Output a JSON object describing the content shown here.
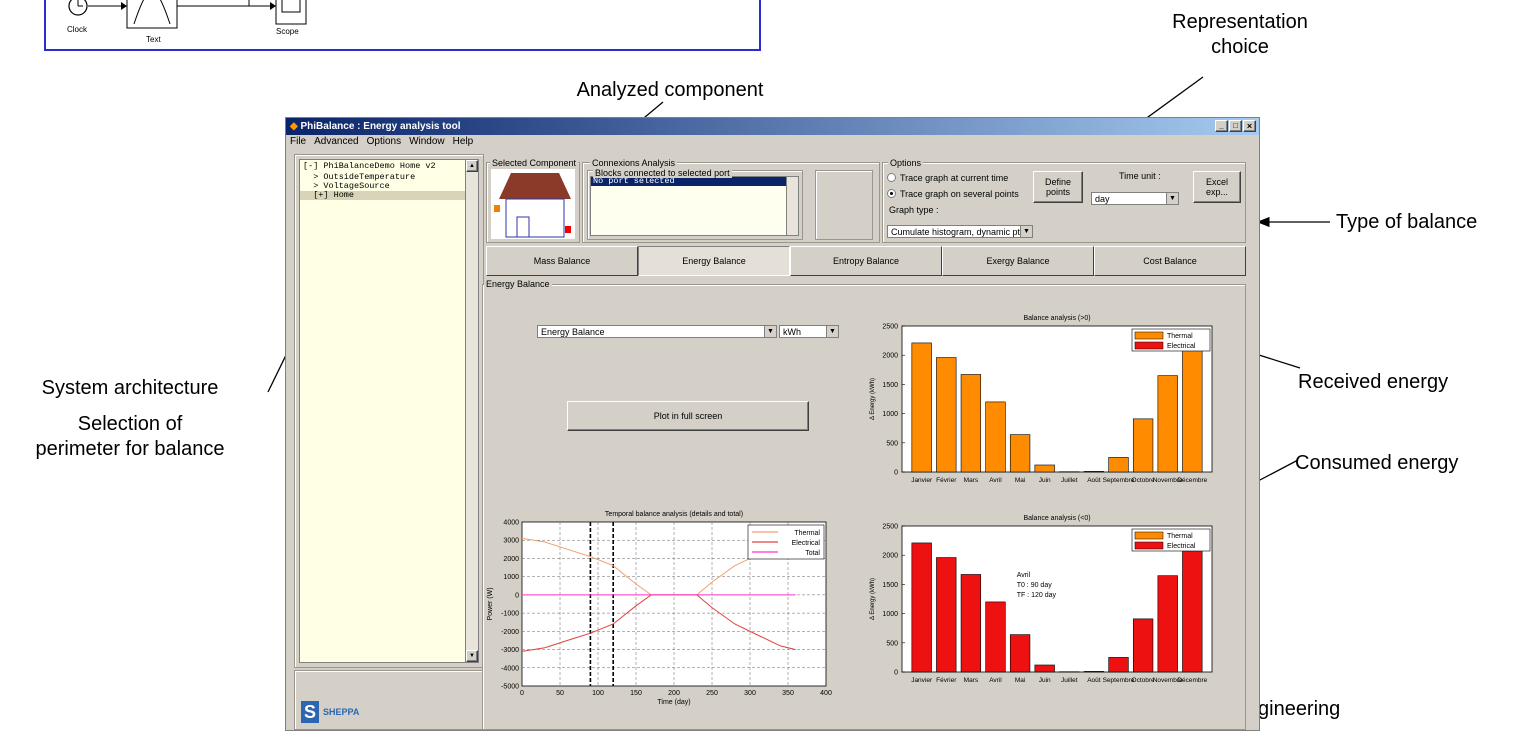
{
  "simulink": {
    "clock_label": "Clock",
    "text_label": "Text",
    "scope_label": "Scope"
  },
  "annotations": {
    "representation_choice_1": "Representation",
    "representation_choice_2": "choice",
    "analyzed_component": "Analyzed component",
    "type_of_balance": "Type of balance",
    "system_architecture": "System architecture",
    "selection_1": "Selection of",
    "selection_2": "perimeter for balance",
    "received_energy": "Received energy",
    "consumed_energy": "Consumed energy",
    "engineering_partial": "gineering"
  },
  "window": {
    "title": "PhiBalance : Energy analysis tool",
    "menu": [
      "File",
      "Advanced",
      "Options",
      "Window",
      "Help"
    ],
    "controls": [
      "_",
      "□",
      "×"
    ]
  },
  "tree": {
    "items": [
      "[-] PhiBalanceDemo Home v2",
      "  > OutsideTemperature",
      "  > VoltageSource",
      "  [+] Home"
    ]
  },
  "logo_text": "SHEPPA",
  "selected_component": {
    "label": "Selected Component"
  },
  "connexions": {
    "label": "Connexions Analysis",
    "sublabel": "Blocks connected to selected port",
    "selected_item": "No port selected"
  },
  "options": {
    "label": "Options",
    "radio_current": "Trace graph at current time",
    "radio_several": "Trace graph on several points",
    "selected_radio": "several",
    "define_points": "Define points",
    "time_unit_label": "Time unit :",
    "time_unit_value": "day",
    "excel_export": "Excel exp...",
    "graph_type_label": "Graph type :",
    "graph_type_value": "Cumulate histogram, dynamic pts."
  },
  "tabs": [
    "Mass Balance",
    "Energy Balance",
    "Entropy Balance",
    "Exergy Balance",
    "Cost Balance"
  ],
  "active_tab": "Energy Balance",
  "energy_panel": {
    "label": "Energy Balance",
    "balance_select": "Energy Balance",
    "unit_select": "kWh",
    "plot_fullscreen": "Plot in full screen"
  },
  "chart_data": [
    {
      "type": "bar",
      "title": "Balance analysis  (>0)",
      "ylabel": "Δ Energy (kWh)",
      "ylim": [
        0,
        2500
      ],
      "yticks": [
        0,
        500,
        1000,
        1500,
        2000,
        2500
      ],
      "categories": [
        "Janvier",
        "Février",
        "Mars",
        "Avril",
        "Mai",
        "Juin",
        "Juillet",
        "Août",
        "Septembre",
        "Octobre",
        "Novembre",
        "Décembre"
      ],
      "tick_labels": [
        "Janvier",
        "Février",
        "Mars",
        "Avril",
        "Mai",
        "Juin",
        "Juillet",
        "Août",
        "Septembre",
        "Octobre",
        "Novembre",
        "Décembre"
      ],
      "series": [
        {
          "name": "Thermal",
          "color": "#ff8c00",
          "values": [
            2210,
            1960,
            1670,
            1200,
            640,
            120,
            5,
            10,
            250,
            910,
            1650,
            2180
          ]
        },
        {
          "name": "Electrical",
          "color": "#ee1111",
          "values": [
            0,
            0,
            0,
            0,
            0,
            0,
            0,
            0,
            0,
            0,
            0,
            0
          ]
        }
      ],
      "legend": "top-right",
      "grid": false
    },
    {
      "type": "bar",
      "title": "Balance analysis  (<0)",
      "ylabel": "Δ Energy (kWh)",
      "ylim": [
        0,
        2500
      ],
      "yticks": [
        0,
        500,
        1000,
        1500,
        2000,
        2500
      ],
      "categories": [
        "Janvier",
        "Février",
        "Mars",
        "Avril",
        "Mai",
        "Juin",
        "Juillet",
        "Août",
        "Septembre",
        "Octobre",
        "Novembre",
        "Décembre"
      ],
      "tick_labels": [
        "Janvier",
        "Février",
        "Mars",
        "Avril",
        "Mai",
        "Juin",
        "Juillet",
        "Août",
        "Septembre",
        "Octobre",
        "Novembre",
        "Décembre"
      ],
      "series": [
        {
          "name": "Thermal",
          "color": "#ff8c00",
          "values": [
            0,
            0,
            0,
            0,
            0,
            0,
            0,
            0,
            0,
            0,
            0,
            0
          ]
        },
        {
          "name": "Electrical",
          "color": "#ee1111",
          "values": [
            2210,
            1960,
            1670,
            1200,
            640,
            120,
            5,
            10,
            250,
            910,
            1650,
            2180
          ]
        }
      ],
      "legend": "top-right",
      "grid": false,
      "annotation": [
        "Avril",
        "T0 : 90 day",
        "TF : 120 day"
      ]
    },
    {
      "type": "line",
      "title": "Temporal balance analysis  (details and total)",
      "xlabel": "Time (day)",
      "ylabel": "Power (W)",
      "xlim": [
        0,
        400
      ],
      "ylim": [
        -5000,
        4000
      ],
      "xticks": [
        0,
        50,
        100,
        150,
        200,
        250,
        300,
        350,
        400
      ],
      "yticks": [
        -5000,
        -4000,
        -3000,
        -2000,
        -1000,
        0,
        1000,
        2000,
        3000,
        4000
      ],
      "grid": true,
      "legend": "top-right",
      "vertical_markers": [
        90,
        120
      ],
      "series": [
        {
          "name": "Thermal",
          "color": "#f0a070",
          "x": [
            0,
            30,
            60,
            90,
            120,
            150,
            170,
            230,
            250,
            280,
            310,
            340,
            360
          ],
          "y": [
            3100,
            2900,
            2500,
            2100,
            1600,
            600,
            0,
            0,
            700,
            1600,
            2200,
            2800,
            3000
          ]
        },
        {
          "name": "Electrical",
          "color": "#e04040",
          "x": [
            0,
            30,
            60,
            90,
            120,
            150,
            170,
            230,
            250,
            280,
            310,
            340,
            360
          ],
          "y": [
            -3100,
            -2900,
            -2500,
            -2100,
            -1600,
            -600,
            0,
            0,
            -700,
            -1600,
            -2200,
            -2800,
            -3000
          ]
        },
        {
          "name": "Total",
          "color": "#ff33cc",
          "x": [
            0,
            360
          ],
          "y": [
            0,
            0
          ]
        }
      ]
    }
  ]
}
